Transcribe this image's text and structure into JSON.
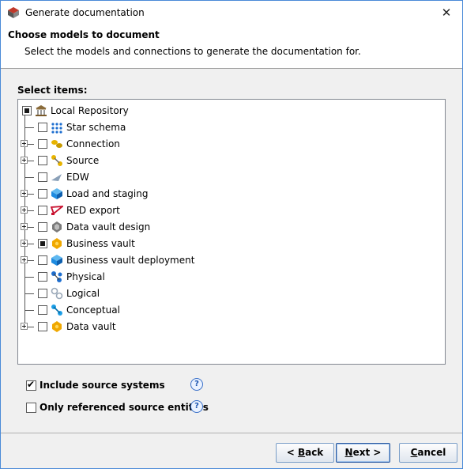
{
  "window": {
    "title": "Generate documentation",
    "close_symbol": "✕"
  },
  "header": {
    "title": "Choose models to document",
    "subtitle": "Select the models and connections to generate the documentation for."
  },
  "tree": {
    "label": "Select items:",
    "root": {
      "label": "Local Repository",
      "state": "partial",
      "icon": "repository-icon"
    },
    "items": [
      {
        "label": "Star schema",
        "checked": false,
        "expandable": false,
        "icon": "star-schema-icon",
        "color": "#1e6fd0"
      },
      {
        "label": "Connection",
        "checked": false,
        "expandable": true,
        "icon": "connection-icon",
        "color": "#e8b400"
      },
      {
        "label": "Source",
        "checked": false,
        "expandable": true,
        "icon": "source-icon",
        "color": "#e8b400"
      },
      {
        "label": "EDW",
        "checked": false,
        "expandable": false,
        "icon": "edw-icon",
        "color": "#8aa0b8"
      },
      {
        "label": "Load and staging",
        "checked": false,
        "expandable": true,
        "icon": "load-staging-icon",
        "color": "#1e8be0"
      },
      {
        "label": "RED export",
        "checked": false,
        "expandable": true,
        "icon": "red-export-icon",
        "color": "#c8102e"
      },
      {
        "label": "Data vault design",
        "checked": false,
        "expandable": true,
        "icon": "data-vault-design-icon",
        "color": "#7a7a7a"
      },
      {
        "label": "Business vault",
        "checked": false,
        "state": "partial",
        "expandable": true,
        "icon": "business-vault-icon",
        "color": "#f0a800"
      },
      {
        "label": "Business vault deployment",
        "checked": false,
        "expandable": true,
        "icon": "business-vault-deployment-icon",
        "color": "#1e8be0"
      },
      {
        "label": "Physical",
        "checked": false,
        "expandable": false,
        "icon": "physical-icon",
        "color": "#1e6fd0"
      },
      {
        "label": "Logical",
        "checked": false,
        "expandable": false,
        "icon": "logical-icon",
        "color": "#9aa8b8"
      },
      {
        "label": "Conceptual",
        "checked": false,
        "expandable": false,
        "icon": "conceptual-icon",
        "color": "#1ea0e8"
      },
      {
        "label": "Data vault",
        "checked": false,
        "expandable": true,
        "icon": "data-vault-icon",
        "color": "#f0a800"
      }
    ]
  },
  "options": {
    "include_source_systems": {
      "label": "Include source systems",
      "checked": true
    },
    "only_referenced": {
      "label": "Only referenced source entities",
      "checked": false
    },
    "help_symbol": "?"
  },
  "buttons": {
    "back": {
      "prefix": "< ",
      "mnemonic": "B",
      "rest": "ack"
    },
    "next": {
      "mnemonic": "N",
      "rest": "ext >"
    },
    "cancel": {
      "mnemonic": "C",
      "rest": "ancel"
    }
  }
}
